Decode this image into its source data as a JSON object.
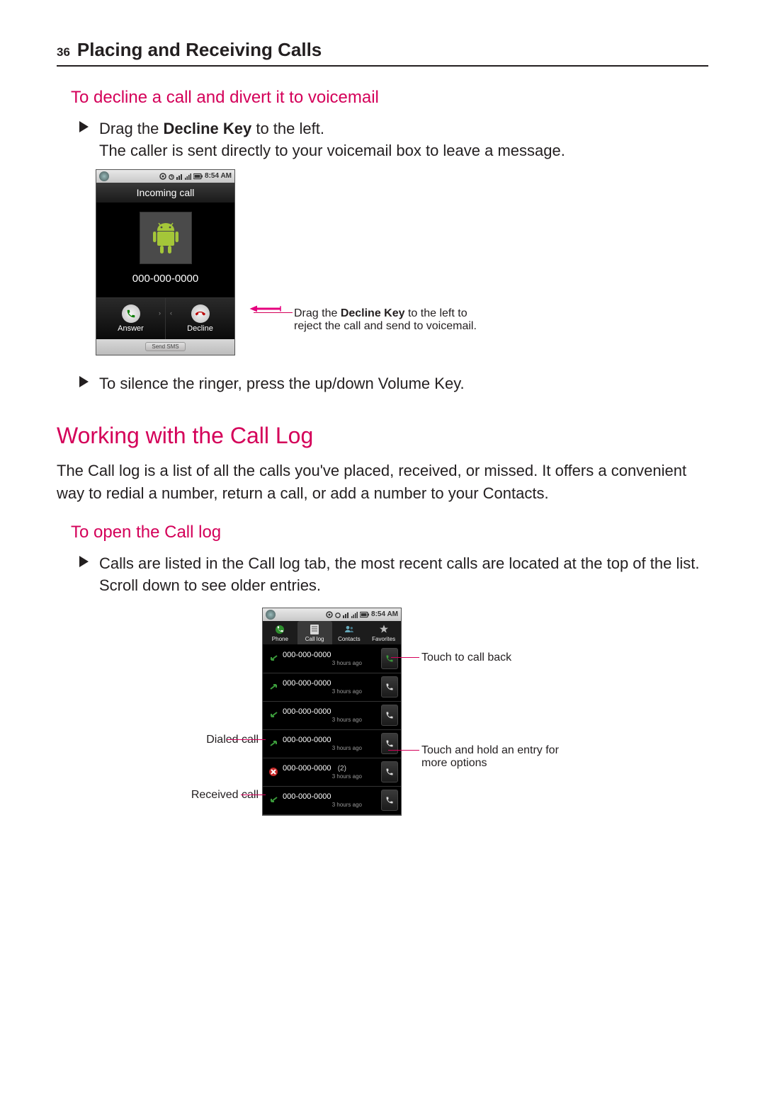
{
  "header": {
    "page_number": "36",
    "title": "Placing and Receiving Calls"
  },
  "section1": {
    "heading": "To decline a call and divert it to voicemail",
    "bullet1_prefix": "Drag the ",
    "bullet1_bold": "Decline Key",
    "bullet1_suffix": " to the left.",
    "bullet1_cont": "The caller is sent directly to your voicemail box to leave a message.",
    "bullet2": "To silence the ringer, press the up/down Volume Key."
  },
  "phone1": {
    "status_time": "8:54 AM",
    "banner": "Incoming call",
    "number": "000-000-0000",
    "answer": "Answer",
    "decline": "Decline",
    "send_sms": "Send SMS"
  },
  "callout1_a": "Drag the ",
  "callout1_b": "Decline Key",
  "callout1_c": " to the left to",
  "callout1_line2": "reject the call and send to voicemail.",
  "section2": {
    "heading": "Working with the Call Log",
    "body": "The Call log is a list of all the calls you've placed, received, or missed. It offers a convenient way to redial a number, return a call, or add a number to your Contacts."
  },
  "section3": {
    "heading": "To open the Call log",
    "bullet": "Calls are listed in the Call log tab, the most recent calls are located at the top of the list. Scroll down to see older entries."
  },
  "phone2": {
    "status_time": "8:54 AM",
    "tabs": {
      "phone": "Phone",
      "call_log": "Call log",
      "contacts": "Contacts",
      "favorites": "Favorites"
    },
    "entries": [
      {
        "type": "received",
        "number": "000-000-0000",
        "sub": "3 hours ago",
        "count": ""
      },
      {
        "type": "dialed",
        "number": "000-000-0000",
        "sub": "3 hours ago",
        "count": ""
      },
      {
        "type": "received",
        "number": "000-000-0000",
        "sub": "3 hours ago",
        "count": ""
      },
      {
        "type": "dialed",
        "number": "000-000-0000",
        "sub": "3 hours ago",
        "count": ""
      },
      {
        "type": "missed",
        "number": "000-000-0000",
        "sub": "3 hours ago",
        "count": "(2)"
      },
      {
        "type": "received",
        "number": "000-000-0000",
        "sub": "3 hours ago",
        "count": ""
      }
    ]
  },
  "callouts2": {
    "dialed": "Dialed call",
    "received": "Received call",
    "call_back": "Touch to call back",
    "hold_line1": "Touch and hold an entry for",
    "hold_line2": "more options"
  }
}
